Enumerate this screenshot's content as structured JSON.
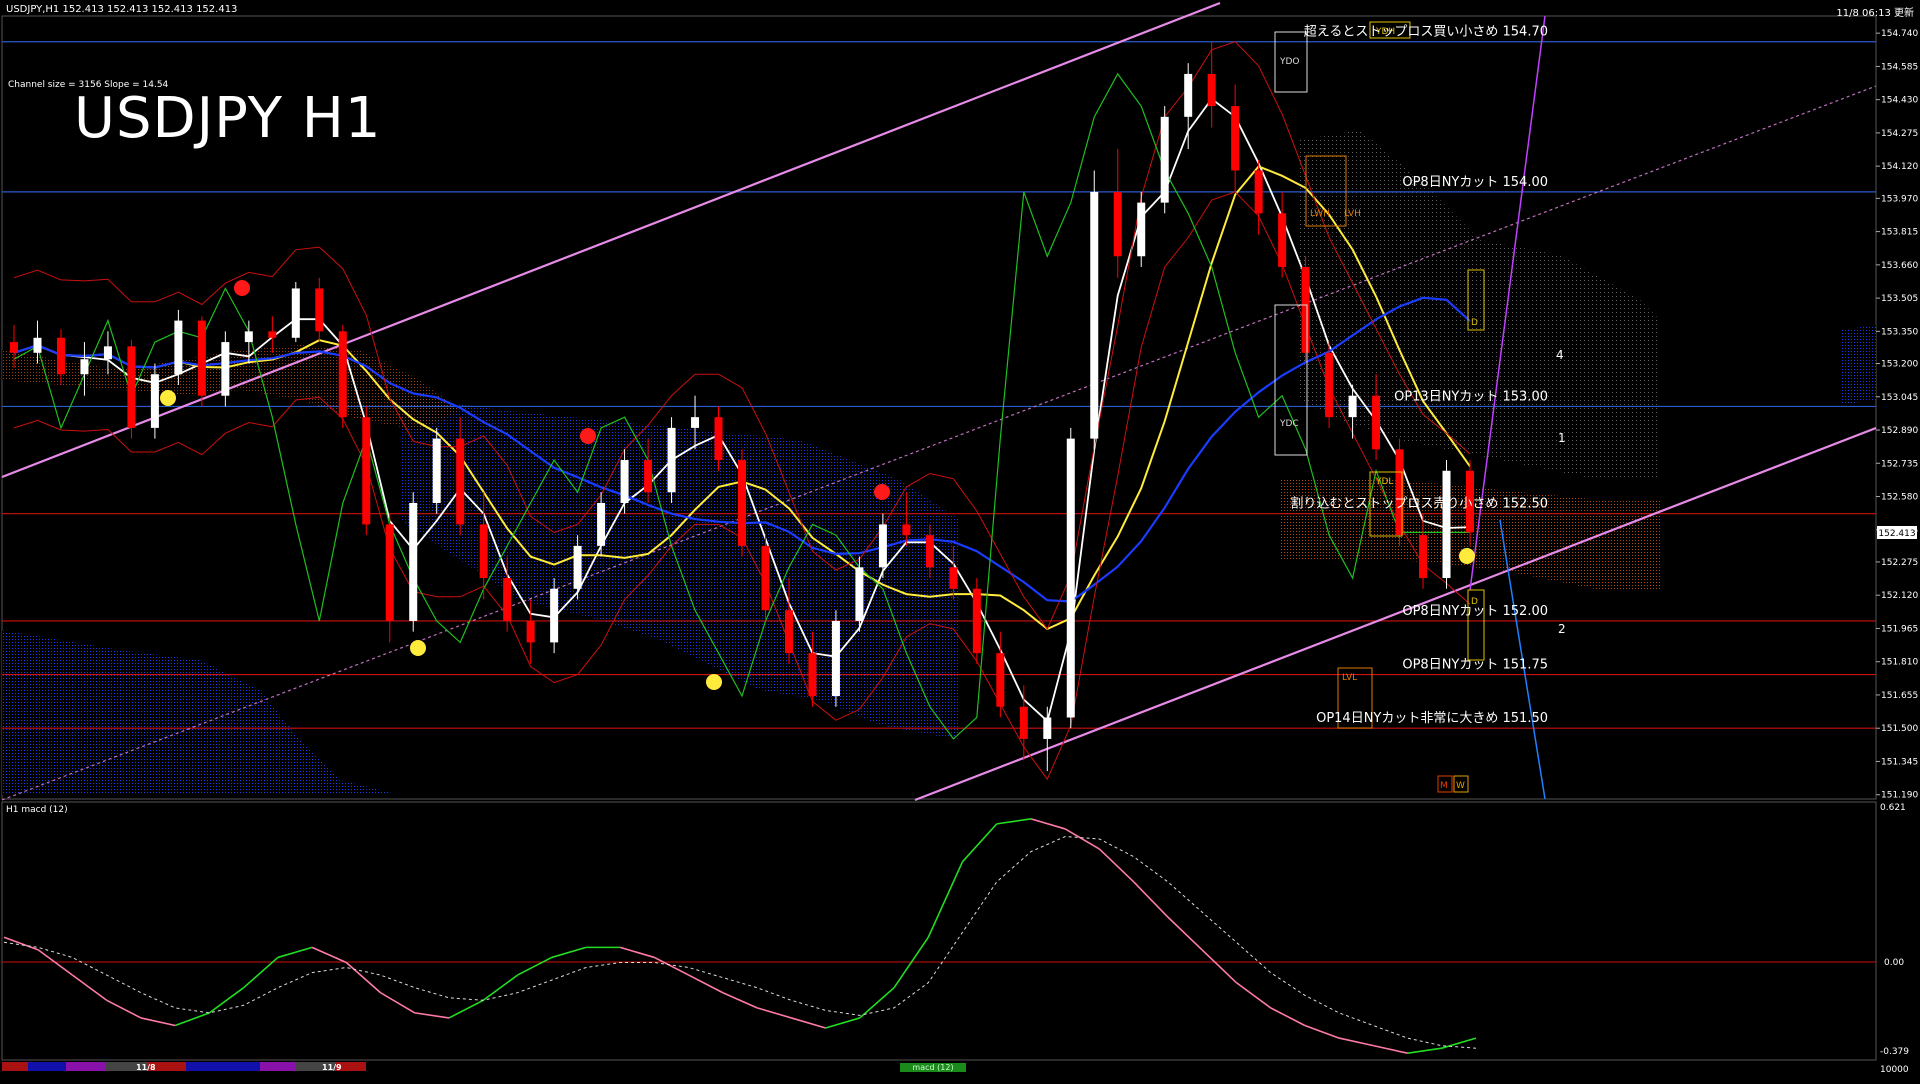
{
  "header": {
    "symbol_info": "USDJPY,H1  152.413 152.413 152.413 152.413",
    "datetime": "11/8 06:13 更新"
  },
  "overlay": {
    "channel_info": "Channel size = 3156 Slope = 14.54",
    "big_title": "USDJPY H1"
  },
  "sub_panel": {
    "label": "H1  macd (12)",
    "y_top_label": "0.621",
    "y_zero_label": "0.00",
    "y_bottom_label": "-0.379",
    "y_extra_label": "10000",
    "footer_labels": [
      "11/8",
      "11/9"
    ],
    "indicator_tag": "macd (12)"
  },
  "price_tag": "152.413",
  "annotations": [
    {
      "text": "超えるとストップロス買い小さめ 154.70",
      "price": 154.7
    },
    {
      "text": "OP8日NYカット 154.00",
      "price": 154.0
    },
    {
      "text": "OP13日NYカット 153.00",
      "price": 153.0
    },
    {
      "text": "割り込むとストップロス売り小さめ 152.50",
      "price": 152.5
    },
    {
      "text": "OP8日NYカット 152.00",
      "price": 152.0
    },
    {
      "text": "OP8日NYカット 151.75",
      "price": 151.75
    },
    {
      "text": "OP14日NYカット非常に大きめ 151.50",
      "price": 151.5
    }
  ],
  "box_labels": [
    "YDH",
    "YDO",
    "YDC",
    "YDL",
    "LWH",
    "LVH",
    "LVL",
    "D",
    "D",
    "M",
    "W"
  ],
  "wave_labels": [
    "1",
    "2",
    "4"
  ],
  "colors": {
    "bull": "#ffffff",
    "bear": "#ff0000",
    "blue_line": "#1a3cff",
    "yellow_line": "#ffeb3b",
    "white_line": "#ffffff",
    "green_line": "#1fbf1f",
    "magenta_line": "#ff66ff",
    "cloud_blue": "#0a1a88",
    "cloud_orange": "#d04a00",
    "macd_green": "#22dd22",
    "macd_pink": "#ff7aa8",
    "hline_blue": "#2a5acc",
    "hline_red": "#cc1111"
  },
  "chart_data": {
    "type": "candlestick",
    "symbol": "USDJPY",
    "timeframe": "H1",
    "y_ticks": [
      154.74,
      154.585,
      154.43,
      154.275,
      154.12,
      153.97,
      153.815,
      153.66,
      153.505,
      153.35,
      153.2,
      153.045,
      152.89,
      152.735,
      152.58,
      152.425,
      152.275,
      152.12,
      151.965,
      151.81,
      151.655,
      151.5,
      151.345,
      151.19
    ],
    "y_range": [
      151.17,
      154.82
    ],
    "current_price": 152.413,
    "candles": [
      [
        153.3,
        153.38,
        153.18,
        153.25
      ],
      [
        153.25,
        153.4,
        153.2,
        153.32
      ],
      [
        153.32,
        153.36,
        153.1,
        153.15
      ],
      [
        153.15,
        153.3,
        153.05,
        153.22
      ],
      [
        153.22,
        153.35,
        153.15,
        153.28
      ],
      [
        153.28,
        153.31,
        152.85,
        152.9
      ],
      [
        152.9,
        153.2,
        152.85,
        153.15
      ],
      [
        153.15,
        153.45,
        153.1,
        153.4
      ],
      [
        153.4,
        153.42,
        153.0,
        153.05
      ],
      [
        153.05,
        153.35,
        153.0,
        153.3
      ],
      [
        153.3,
        153.4,
        153.2,
        153.35
      ],
      [
        153.35,
        153.42,
        153.25,
        153.32
      ],
      [
        153.32,
        153.58,
        153.3,
        153.55
      ],
      [
        153.55,
        153.6,
        153.3,
        153.35
      ],
      [
        153.35,
        153.38,
        152.9,
        152.95
      ],
      [
        152.95,
        153.0,
        152.4,
        152.45
      ],
      [
        152.45,
        152.5,
        151.9,
        152.0
      ],
      [
        152.0,
        152.6,
        151.95,
        152.55
      ],
      [
        152.55,
        152.9,
        152.5,
        152.85
      ],
      [
        152.85,
        152.95,
        152.4,
        152.45
      ],
      [
        152.45,
        152.6,
        152.1,
        152.2
      ],
      [
        152.2,
        152.3,
        151.95,
        152.0
      ],
      [
        152.0,
        152.1,
        151.8,
        151.9
      ],
      [
        151.9,
        152.2,
        151.85,
        152.15
      ],
      [
        152.15,
        152.4,
        152.1,
        152.35
      ],
      [
        152.35,
        152.6,
        152.3,
        152.55
      ],
      [
        152.55,
        152.8,
        152.5,
        152.75
      ],
      [
        152.75,
        152.85,
        152.55,
        152.6
      ],
      [
        152.6,
        152.95,
        152.55,
        152.9
      ],
      [
        152.9,
        153.05,
        152.8,
        152.95
      ],
      [
        152.95,
        153.0,
        152.7,
        152.75
      ],
      [
        152.75,
        152.8,
        152.3,
        152.35
      ],
      [
        152.35,
        152.4,
        152.0,
        152.05
      ],
      [
        152.05,
        152.2,
        151.8,
        151.85
      ],
      [
        151.85,
        151.95,
        151.6,
        151.65
      ],
      [
        151.65,
        152.05,
        151.6,
        152.0
      ],
      [
        152.0,
        152.3,
        151.95,
        152.25
      ],
      [
        152.25,
        152.5,
        152.2,
        152.45
      ],
      [
        152.45,
        152.6,
        152.35,
        152.4
      ],
      [
        152.4,
        152.45,
        152.2,
        152.25
      ],
      [
        152.25,
        152.35,
        152.1,
        152.15
      ],
      [
        152.15,
        152.2,
        151.8,
        151.85
      ],
      [
        151.85,
        151.95,
        151.55,
        151.6
      ],
      [
        151.6,
        151.7,
        151.35,
        151.45
      ],
      [
        151.45,
        151.6,
        151.3,
        151.55
      ],
      [
        151.55,
        152.9,
        151.5,
        152.85
      ],
      [
        152.85,
        154.1,
        152.8,
        154.0
      ],
      [
        154.0,
        154.2,
        153.6,
        153.7
      ],
      [
        153.7,
        154.0,
        153.65,
        153.95
      ],
      [
        153.95,
        154.4,
        153.9,
        154.35
      ],
      [
        154.35,
        154.6,
        154.2,
        154.55
      ],
      [
        154.55,
        154.7,
        154.3,
        154.4
      ],
      [
        154.4,
        154.5,
        154.0,
        154.1
      ],
      [
        154.1,
        154.15,
        153.8,
        153.9
      ],
      [
        153.9,
        154.0,
        153.6,
        153.65
      ],
      [
        153.65,
        153.7,
        153.2,
        153.25
      ],
      [
        153.25,
        153.3,
        152.9,
        152.95
      ],
      [
        152.95,
        153.1,
        152.85,
        153.05
      ],
      [
        153.05,
        153.15,
        152.75,
        152.8
      ],
      [
        152.8,
        152.85,
        152.35,
        152.4
      ],
      [
        152.4,
        152.5,
        152.15,
        152.2
      ],
      [
        152.2,
        152.75,
        152.15,
        152.7
      ],
      [
        152.7,
        152.75,
        152.35,
        152.413
      ]
    ],
    "hlines": [
      154.7,
      154.0,
      153.0,
      152.5,
      152.0,
      151.75,
      151.5
    ],
    "macd": {
      "y_range": [
        -0.379,
        0.621
      ],
      "line": [
        0.1,
        0.05,
        -0.05,
        -0.15,
        -0.22,
        -0.25,
        -0.2,
        -0.1,
        0.02,
        0.06,
        0.0,
        -0.12,
        -0.2,
        -0.22,
        -0.15,
        -0.05,
        0.02,
        0.06,
        0.06,
        0.02,
        -0.05,
        -0.12,
        -0.18,
        -0.22,
        -0.26,
        -0.22,
        -0.1,
        0.1,
        0.4,
        0.55,
        0.57,
        0.53,
        0.45,
        0.32,
        0.18,
        0.05,
        -0.08,
        -0.18,
        -0.25,
        -0.3,
        -0.33,
        -0.36,
        -0.34,
        -0.3
      ],
      "signal": [
        0.08,
        0.06,
        0.02,
        -0.05,
        -0.12,
        -0.18,
        -0.2,
        -0.17,
        -0.1,
        -0.04,
        -0.02,
        -0.05,
        -0.1,
        -0.14,
        -0.15,
        -0.12,
        -0.07,
        -0.02,
        0.0,
        0.0,
        -0.02,
        -0.06,
        -0.1,
        -0.15,
        -0.19,
        -0.21,
        -0.18,
        -0.08,
        0.12,
        0.32,
        0.44,
        0.5,
        0.49,
        0.42,
        0.32,
        0.2,
        0.08,
        -0.04,
        -0.13,
        -0.2,
        -0.25,
        -0.3,
        -0.33,
        -0.34
      ]
    }
  }
}
